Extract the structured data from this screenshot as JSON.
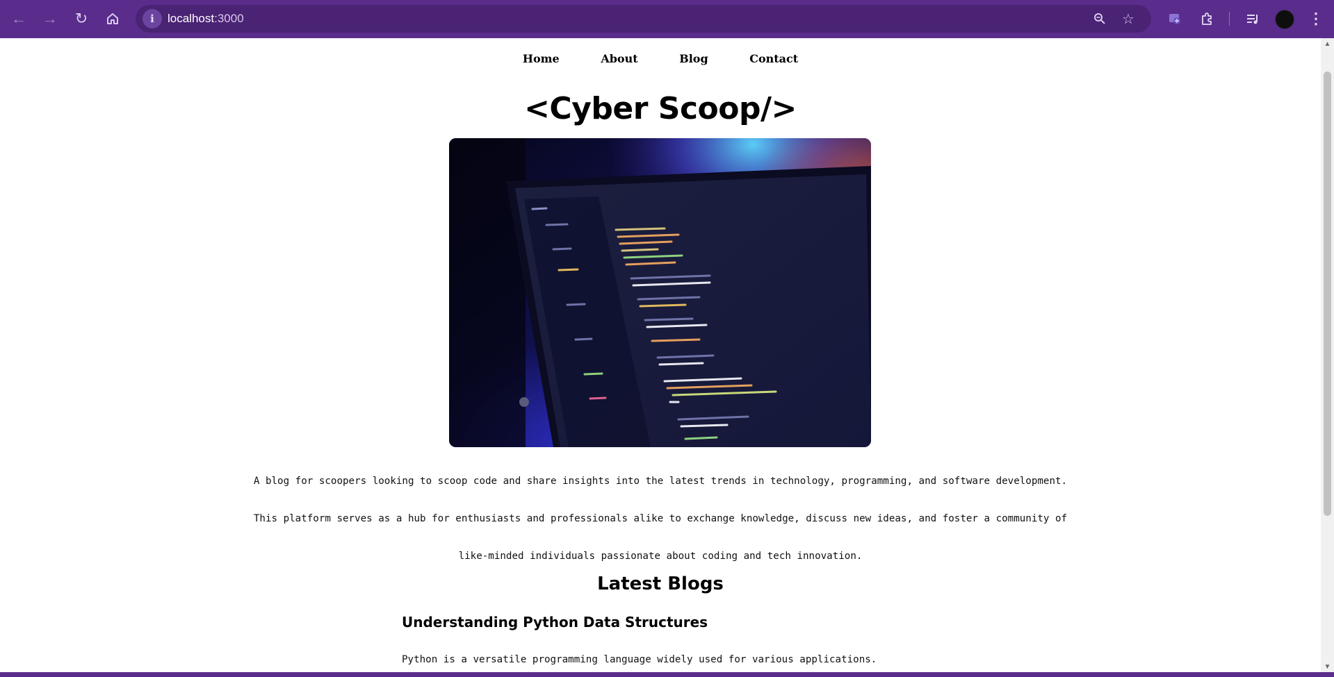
{
  "browser": {
    "url_host": "localhost",
    "url_port": ":3000",
    "icons": [
      "back-icon",
      "forward-icon",
      "reload-icon",
      "home-icon",
      "site-info-icon",
      "zoom-icon",
      "bookmark-star-icon",
      "extension-icon",
      "puzzle-icon",
      "media-queue-icon",
      "profile-avatar",
      "menu-icon"
    ],
    "theme_color": "#5a2d8c"
  },
  "nav": {
    "items": [
      {
        "label": "Home"
      },
      {
        "label": "About"
      },
      {
        "label": "Blog"
      },
      {
        "label": "Contact"
      }
    ]
  },
  "site": {
    "title": "<Cyber Scoop/>",
    "intro_lines": [
      "A blog for scoopers looking to scoop code and share insights into the latest trends in technology, programming, and software development.",
      "This platform serves as a hub for enthusiasts and professionals alike to exchange knowledge, discuss new ideas, and foster a community of",
      "like-minded individuals passionate about coding and tech innovation."
    ]
  },
  "blogs": {
    "heading": "Latest Blogs",
    "posts": [
      {
        "title": "Understanding Python Data Structures",
        "excerpt": "Python is a versatile programming language widely used for various applications."
      }
    ]
  }
}
